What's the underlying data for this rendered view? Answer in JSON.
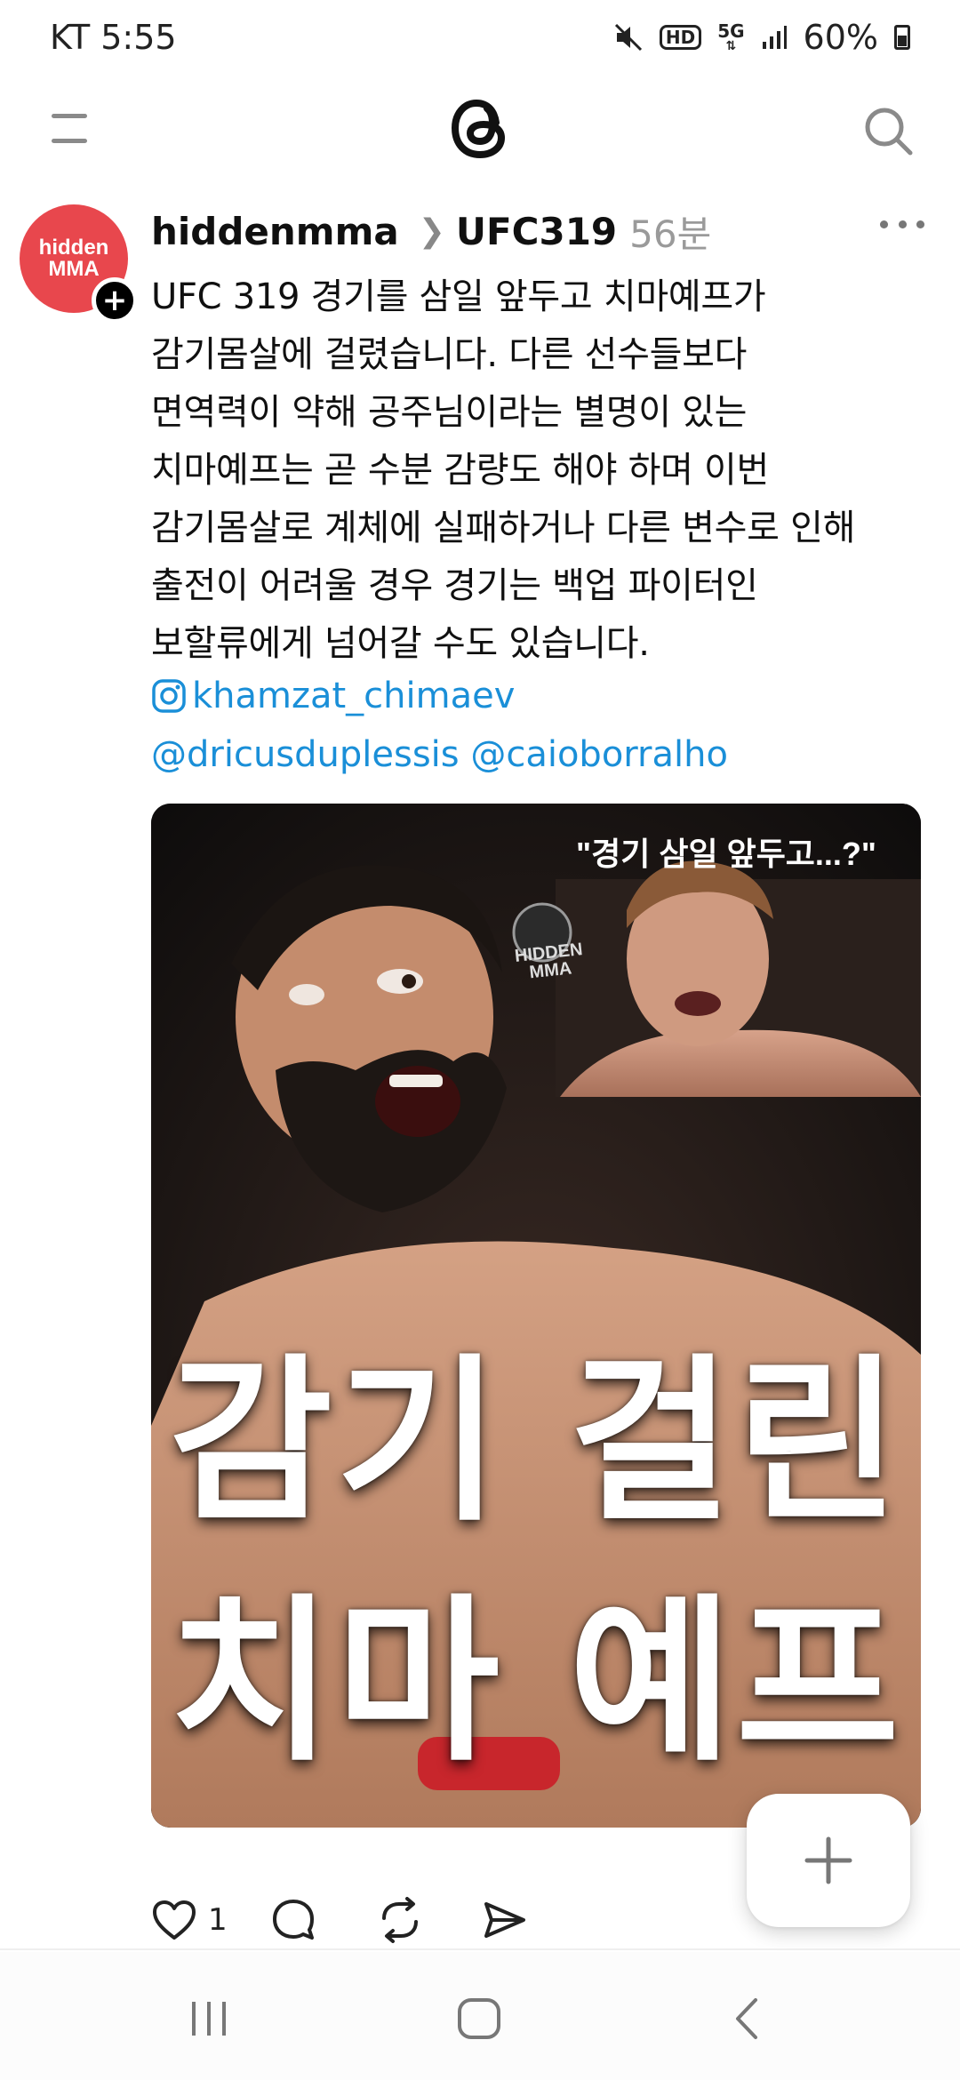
{
  "status_bar": {
    "carrier_time": "KT 5:55",
    "hd": "HD",
    "network": "5G",
    "battery": "60%"
  },
  "app": {
    "logo_icon": "threads-logo-icon",
    "menu_icon": "menu-icon",
    "search_icon": "search-icon"
  },
  "post": {
    "avatar_line1": "hidden",
    "avatar_line2": "MMA",
    "username": "hiddenmma",
    "topic": "UFC319",
    "time": "56분",
    "body": "UFC 319 경기를 삼일 앞두고 치마예프가\n감기몸살에 걸렸습니다. 다른 선수들보다\n면역력이 약해 공주님이라는 별명이 있는\n치마예프는 곧 수분 감량도 해야 하며 이번\n감기몸살로 계체에 실패하거나 다른 변수로 인해\n출전이 어려울 경우 경기는 백업 파이터인\n보할류에게 넘어갈 수도 있습니다.",
    "instagram_link": "khamzat_chimaev",
    "mention1": "@dricusduplessis",
    "mention2": "@caioborralho",
    "image": {
      "caption": "\"경기 삼일 앞두고...?\"",
      "logo_text1": "HIDDEN",
      "logo_text2": "MMA",
      "title_line1": "감기 걸린",
      "title_line2": "치마 예프"
    },
    "likes": "1"
  },
  "colors": {
    "link": "#1a8fd8",
    "avatar_bg": "#e8474d"
  }
}
